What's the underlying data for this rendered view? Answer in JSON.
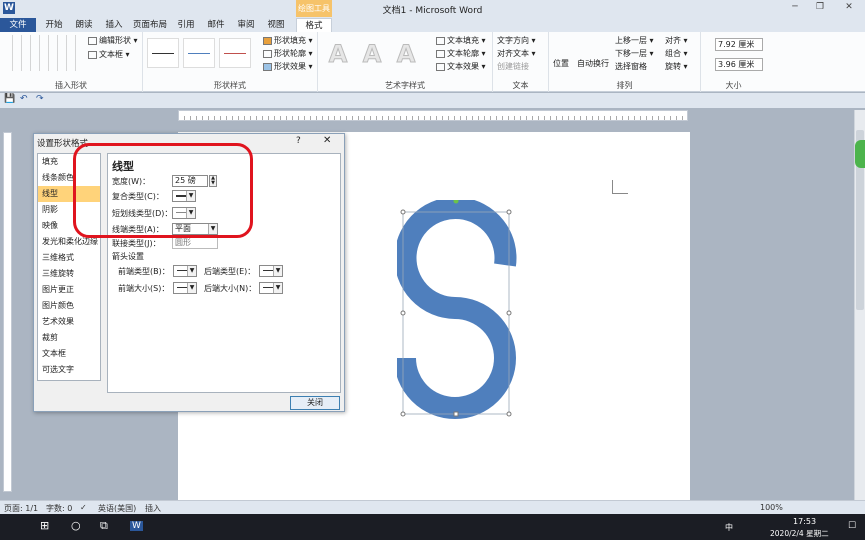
{
  "window": {
    "title": "文档1 - Microsoft Word",
    "context_tab": "绘图工具",
    "app_letter": "W"
  },
  "tabs": [
    "文件",
    "开始",
    "朗读",
    "插入",
    "页面布局",
    "引用",
    "邮件",
    "审阅",
    "视图",
    "格式"
  ],
  "ribbon": {
    "insert_shapes": {
      "label": "插入形状",
      "edit_shape": "编辑形状 ▾",
      "text_box": "文本框 ▾"
    },
    "shape_styles": {
      "label": "形状样式",
      "fill": "形状填充 ▾",
      "outline": "形状轮廓 ▾",
      "effect": "形状效果 ▾"
    },
    "art_styles": {
      "label": "艺术字样式",
      "a_glyph": "A",
      "text_fill": "文本填充 ▾",
      "text_outline": "文本轮廓 ▾",
      "text_effect": "文本效果 ▾"
    },
    "text": {
      "label": "文本",
      "direction": "文字方向 ▾",
      "align": "对齐文本 ▾",
      "link": "创建链接"
    },
    "arrange": {
      "label": "排列",
      "position": "位置",
      "wrap": "自动换行",
      "forward": "上移一层 ▾",
      "backward": "下移一层 ▾",
      "pane": "选择窗格",
      "align": "对齐 ▾",
      "group": "组合 ▾",
      "rotate": "旋转 ▾"
    },
    "size": {
      "label": "大小",
      "height": "7.92 厘米",
      "width": "3.96 厘米"
    }
  },
  "dialog": {
    "title": "设置形状格式",
    "help": "?",
    "close_x": "✕",
    "categories": [
      "填充",
      "线条颜色",
      "线型",
      "阴影",
      "映像",
      "发光和柔化边缘",
      "三维格式",
      "三维旋转",
      "图片更正",
      "图片颜色",
      "艺术效果",
      "裁剪",
      "文本框",
      "可选文字"
    ],
    "selected_category": "线型",
    "heading": "线型",
    "width_label": "宽度(W)：",
    "width_value": "25 磅",
    "compound_label": "复合类型(C)：",
    "dash_label": "短划线类型(D)：",
    "cap_label": "线端类型(A)：",
    "cap_value": "平面",
    "join_label": "联接类型(J)：",
    "join_value": "圆形",
    "arrow_heading": "箭头设置",
    "begin_type": "前端类型(B)：",
    "end_type": "后端类型(E)：",
    "begin_size": "前端大小(S)：",
    "end_size": "后端大小(N)：",
    "close_button": "关闭"
  },
  "status": {
    "page": "页面: 1/1",
    "words": "字数: 0",
    "lang": "英语(美国)",
    "mode": "插入",
    "zoom_pct": "100%"
  },
  "taskbar": {
    "time": "17:53",
    "date": "2020/2/4 星期二",
    "ime": "中"
  },
  "colors": {
    "shape_fill": "#4f7fbd",
    "highlight": "#e0141e",
    "accent": "#2b579a"
  }
}
